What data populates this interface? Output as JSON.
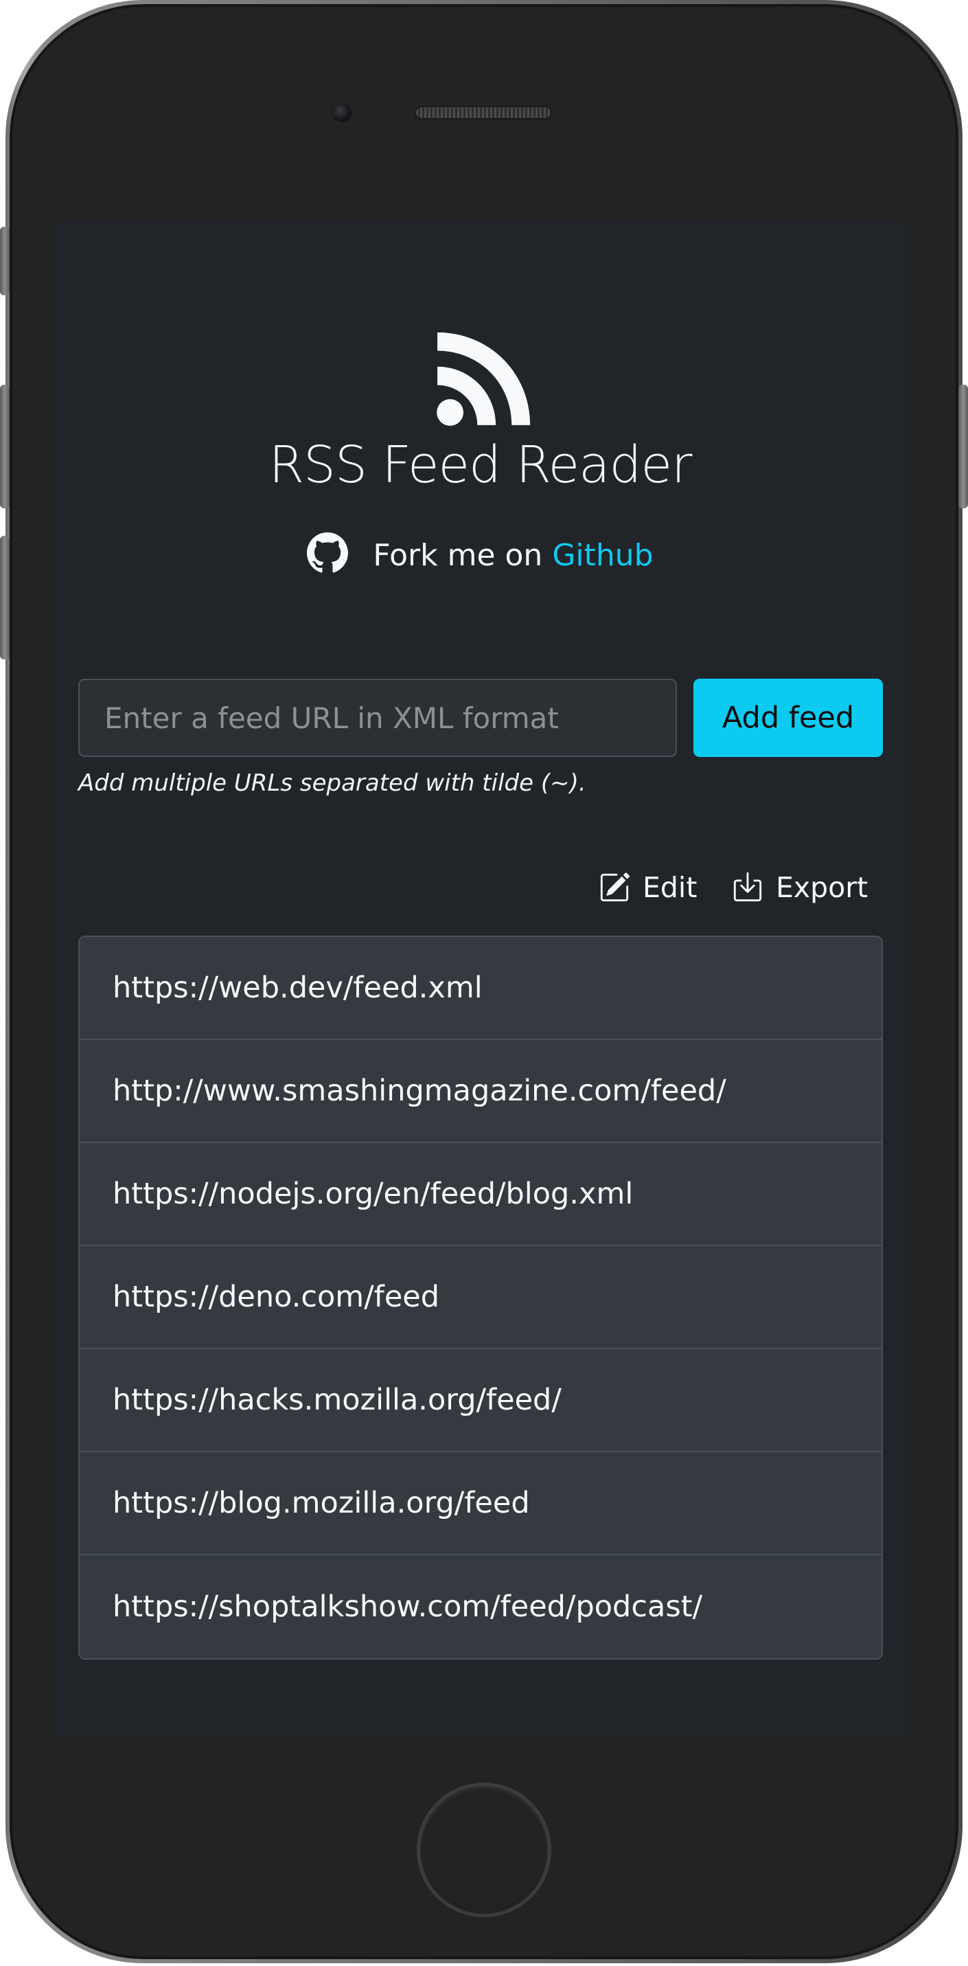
{
  "app": {
    "title": "RSS Feed Reader",
    "logo_icon": "rss-icon",
    "accent_color": "#0dcaf0"
  },
  "fork": {
    "prefix": "Fork me on",
    "link_label": "Github",
    "icon": "github-icon"
  },
  "form": {
    "input_placeholder": "Enter a feed URL in XML format",
    "input_value": "",
    "add_button_label": "Add feed",
    "hint": "Add multiple URLs separated with tilde (~)."
  },
  "toolbar": {
    "edit_label": "Edit",
    "edit_icon": "edit-icon",
    "export_label": "Export",
    "export_icon": "download-icon"
  },
  "feeds": [
    "https://web.dev/feed.xml",
    "http://www.smashingmagazine.com/feed/",
    "https://nodejs.org/en/feed/blog.xml",
    "https://deno.com/feed",
    "https://hacks.mozilla.org/feed/",
    "https://blog.mozilla.org/feed",
    "https://shoptalkshow.com/feed/podcast/"
  ]
}
